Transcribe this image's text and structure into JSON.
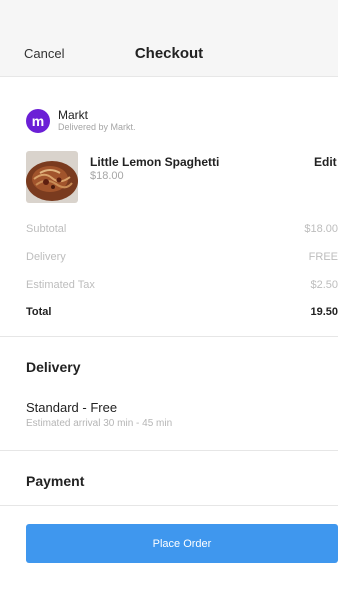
{
  "header": {
    "cancel_label": "Cancel",
    "title": "Checkout"
  },
  "store": {
    "name": "Markt",
    "subtitle": "Delivered by Markt.",
    "logo_letter": "m",
    "brand_color": "#6b1fd6"
  },
  "item": {
    "name": "Little Lemon Spaghetti",
    "price": "$18.00",
    "edit_label": "Edit"
  },
  "summary": {
    "subtotal": {
      "label": "Subtotal",
      "value": "$18.00"
    },
    "delivery": {
      "label": "Delivery",
      "value": "FREE"
    },
    "tax": {
      "label": "Estimated Tax",
      "value": "$2.50"
    },
    "total": {
      "label": "Total",
      "value": "19.50"
    }
  },
  "delivery_section": {
    "title": "Delivery",
    "option": "Standard - Free",
    "estimate": "Estimated arrival 30 min - 45 min"
  },
  "payment_section": {
    "title": "Payment"
  },
  "place_order": {
    "label": "Place Order",
    "color": "#3f97ee"
  }
}
